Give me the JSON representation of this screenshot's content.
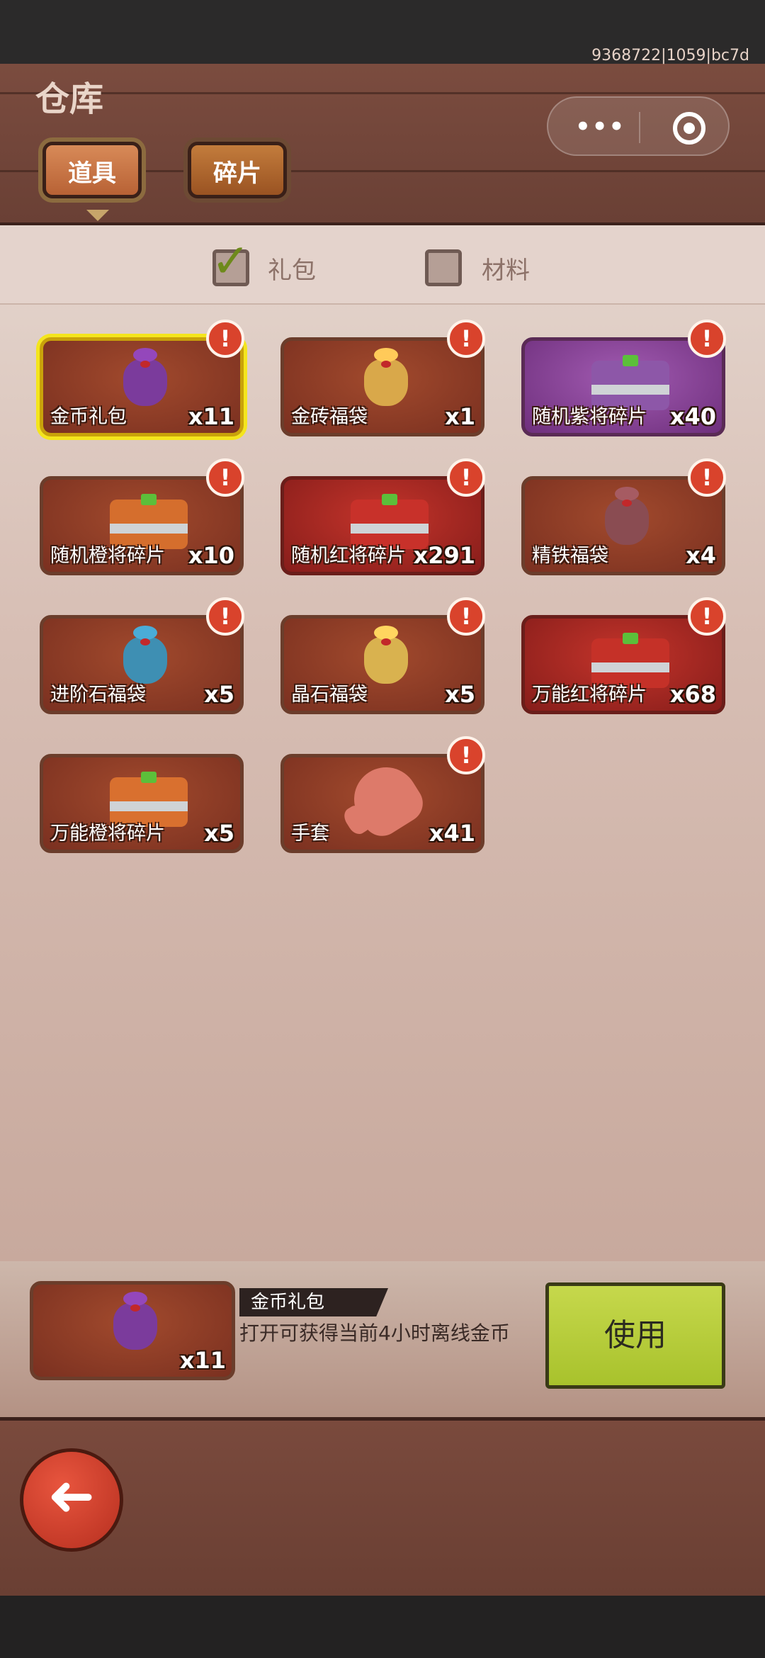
{
  "window": {
    "title": "仓库",
    "build_id": "9368722|1059|bc7d"
  },
  "tabs": [
    {
      "label": "道具",
      "active": true
    },
    {
      "label": "碎片",
      "active": false
    }
  ],
  "filters": [
    {
      "label": "礼包",
      "checked": true
    },
    {
      "label": "材料",
      "checked": false
    }
  ],
  "items": [
    {
      "name": "金币礼包",
      "count": "x11",
      "badge": "!",
      "style": "normal",
      "selected": true,
      "icon": "gold-coin-bag-icon"
    },
    {
      "name": "金砖福袋",
      "count": "x1",
      "badge": "!",
      "style": "normal",
      "selected": false,
      "icon": "gold-brick-bag-icon"
    },
    {
      "name": "随机紫将碎片",
      "count": "x40",
      "badge": "!",
      "style": "purple",
      "selected": false,
      "icon": "purple-chest-icon"
    },
    {
      "name": "随机橙将碎片",
      "count": "x10",
      "badge": "!",
      "style": "normal",
      "selected": false,
      "icon": "orange-chest-icon"
    },
    {
      "name": "随机红将碎片",
      "count": "x291",
      "badge": "!",
      "style": "red",
      "selected": false,
      "icon": "red-chest-icon"
    },
    {
      "name": "精铁福袋",
      "count": "x4",
      "badge": "!",
      "style": "normal",
      "selected": false,
      "icon": "iron-bag-icon"
    },
    {
      "name": "进阶石福袋",
      "count": "x5",
      "badge": "!",
      "style": "normal",
      "selected": false,
      "icon": "advance-stone-bag-icon"
    },
    {
      "name": "晶石福袋",
      "count": "x5",
      "badge": "!",
      "style": "normal",
      "selected": false,
      "icon": "crystal-bag-icon"
    },
    {
      "name": "万能红将碎片",
      "count": "x68",
      "badge": "!",
      "style": "red",
      "selected": false,
      "icon": "universal-red-chest-icon"
    },
    {
      "name": "万能橙将碎片",
      "count": "x5",
      "badge": "",
      "style": "normal",
      "selected": false,
      "icon": "universal-orange-chest-icon"
    },
    {
      "name": "手套",
      "count": "x41",
      "badge": "!",
      "style": "normal",
      "selected": false,
      "icon": "glove-icon"
    }
  ],
  "detail": {
    "name": "金币礼包",
    "count": "x11",
    "description": "打开可获得当前4小时离线金币",
    "use_label": "使用"
  },
  "capsule": {
    "more": "•••"
  },
  "back": {
    "glyph": "➜"
  },
  "colors": {
    "accent_green": "#a8c22c",
    "badge_red": "#d9432c",
    "selected_yellow": "#f4e51d"
  }
}
